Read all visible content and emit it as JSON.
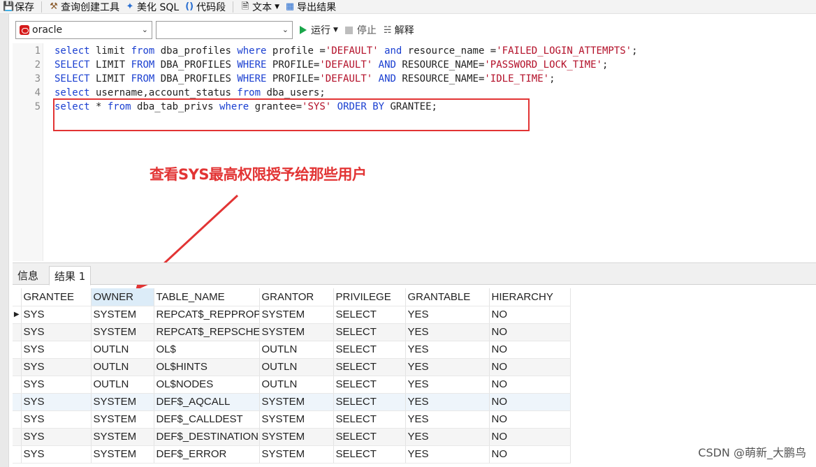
{
  "toolbar": {
    "save": "保存",
    "query_builder": "查询创建工具",
    "beautify": "美化 SQL",
    "snippet": "代码段",
    "text": "文本",
    "export": "导出结果"
  },
  "connection": {
    "db": "oracle",
    "schema": "",
    "run": "运行",
    "stop": "停止",
    "explain": "解释"
  },
  "editor": {
    "lines": [
      {
        "num": "1",
        "parts": [
          [
            "kw",
            "select"
          ],
          [
            "t",
            " limit "
          ],
          [
            "kw",
            "from"
          ],
          [
            "t",
            " dba_profiles "
          ],
          [
            "kw",
            "where"
          ],
          [
            "t",
            " profile ="
          ],
          [
            "str",
            "'DEFAULT'"
          ],
          [
            "t",
            " "
          ],
          [
            "kw",
            "and"
          ],
          [
            "t",
            " resource_name ="
          ],
          [
            "str",
            "'FAILED_LOGIN_ATTEMPTS'"
          ],
          [
            "t",
            ";"
          ]
        ]
      },
      {
        "num": "2",
        "parts": [
          [
            "kw",
            "SELECT"
          ],
          [
            "t",
            " LIMIT "
          ],
          [
            "kw",
            "FROM"
          ],
          [
            "t",
            " DBA_PROFILES "
          ],
          [
            "kw",
            "WHERE"
          ],
          [
            "t",
            " PROFILE="
          ],
          [
            "str",
            "'DEFAULT'"
          ],
          [
            "t",
            " "
          ],
          [
            "kw",
            "AND"
          ],
          [
            "t",
            " RESOURCE_NAME="
          ],
          [
            "str",
            "'PASSWORD_LOCK_TIME'"
          ],
          [
            "t",
            ";"
          ]
        ]
      },
      {
        "num": "3",
        "parts": [
          [
            "kw",
            "SELECT"
          ],
          [
            "t",
            " LIMIT "
          ],
          [
            "kw",
            "FROM"
          ],
          [
            "t",
            " DBA_PROFILES "
          ],
          [
            "kw",
            "WHERE"
          ],
          [
            "t",
            " PROFILE="
          ],
          [
            "str",
            "'DEFAULT'"
          ],
          [
            "t",
            " "
          ],
          [
            "kw",
            "AND"
          ],
          [
            "t",
            " RESOURCE_NAME="
          ],
          [
            "str",
            "'IDLE_TIME'"
          ],
          [
            "t",
            ";"
          ]
        ]
      },
      {
        "num": "4",
        "parts": [
          [
            "kw",
            "select"
          ],
          [
            "t",
            " username,account_status "
          ],
          [
            "kw",
            "from"
          ],
          [
            "t",
            " dba_users;"
          ]
        ]
      },
      {
        "num": "5",
        "parts": [
          [
            "kw",
            "select"
          ],
          [
            "t",
            " * "
          ],
          [
            "kw",
            "from"
          ],
          [
            "t",
            " dba_tab_privs "
          ],
          [
            "kw",
            "where"
          ],
          [
            "t",
            " grantee="
          ],
          [
            "str",
            "'SYS'"
          ],
          [
            "t",
            " "
          ],
          [
            "kw",
            "ORDER BY"
          ],
          [
            "t",
            " GRANTEE;"
          ]
        ]
      }
    ],
    "annotation": "查看SYS最高权限授予给那些用户"
  },
  "tabs": [
    "信息",
    "结果 1"
  ],
  "grid": {
    "columns": [
      "GRANTEE",
      "OWNER",
      "TABLE_NAME",
      "GRANTOR",
      "PRIVILEGE",
      "GRANTABLE",
      "HIERARCHY"
    ],
    "rows": [
      [
        "SYS",
        "SYSTEM",
        "REPCAT$_REPPROP",
        "SYSTEM",
        "SELECT",
        "YES",
        "NO"
      ],
      [
        "SYS",
        "SYSTEM",
        "REPCAT$_REPSCHEM",
        "SYSTEM",
        "SELECT",
        "YES",
        "NO"
      ],
      [
        "SYS",
        "OUTLN",
        "OL$",
        "OUTLN",
        "SELECT",
        "YES",
        "NO"
      ],
      [
        "SYS",
        "OUTLN",
        "OL$HINTS",
        "OUTLN",
        "SELECT",
        "YES",
        "NO"
      ],
      [
        "SYS",
        "OUTLN",
        "OL$NODES",
        "OUTLN",
        "SELECT",
        "YES",
        "NO"
      ],
      [
        "SYS",
        "SYSTEM",
        "DEF$_AQCALL",
        "SYSTEM",
        "SELECT",
        "YES",
        "NO"
      ],
      [
        "SYS",
        "SYSTEM",
        "DEF$_CALLDEST",
        "SYSTEM",
        "SELECT",
        "YES",
        "NO"
      ],
      [
        "SYS",
        "SYSTEM",
        "DEF$_DESTINATION",
        "SYSTEM",
        "SELECT",
        "YES",
        "NO"
      ],
      [
        "SYS",
        "SYSTEM",
        "DEF$_ERROR",
        "SYSTEM",
        "SELECT",
        "YES",
        "NO"
      ]
    ]
  },
  "watermark": "CSDN @萌新_大鹏鸟",
  "colors": {
    "annotation": "#e23434",
    "keyword": "#1a3fd1",
    "string": "#b30f28"
  }
}
